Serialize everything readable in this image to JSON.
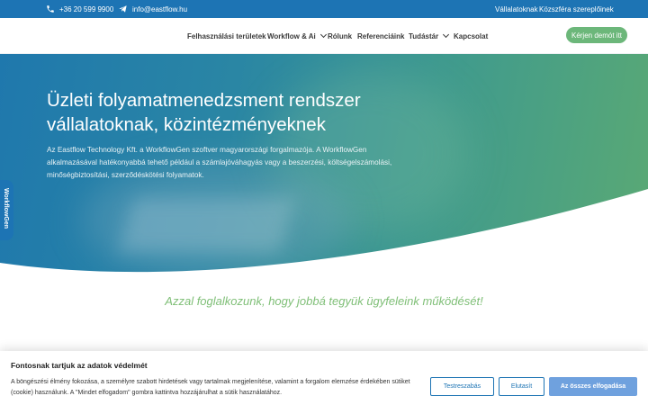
{
  "topbar": {
    "phone": "+36 20 599 9900",
    "email": "info@eastflow.hu",
    "links": [
      "Vállalatoknak",
      "Közszféra szereplőinek"
    ],
    "icons": [
      "phone-icon",
      "send-icon"
    ],
    "color": "#1d74b4"
  },
  "nav": {
    "items": [
      {
        "label": "Felhasználási területek"
      },
      {
        "label": "Workflow & Ai"
      },
      {
        "label": "Rólunk"
      },
      {
        "label": "Referenciáink"
      },
      {
        "label": "Tudástár"
      },
      {
        "label": "Kapcsolat"
      }
    ],
    "demo_button": "Kérjen demót itt",
    "demo_color": "#6cb77a"
  },
  "hero": {
    "title": "Üzleti folyamatmenedzsment rendszer vállalatoknak, közintézményeknek",
    "text": "Az Eastflow Technology Kft. a WorkflowGen szoftver magyarországi forgalmazója. A WorkflowGen alkalmazásával hatékonyabbá tehető például a számlajóváhagyás vagy a beszerzési, költségelszámolási, minőségbiztosítási, szerződéskötési folyamatok."
  },
  "side_tab": {
    "label": "WorkflowGen"
  },
  "tagline": "Azzal foglalkozunk, hogy jobbá tegyük ügyfeleink működését!",
  "cookie": {
    "title": "Fontosnak tartjuk az adatok védelmét",
    "text": "A böngészési élmény fokozása, a személyre szabott hirdetések vagy tartalmak megjelenítése, valamint a forgalom elemzése érdekében sütiket (cookie) használunk. A \"Mindet elfogadom\" gombra kattintva hozzájárulhat a sütik használatához.",
    "buttons": {
      "customize": "Testreszabás",
      "reject": "Elutasít",
      "accept_all": "Az összes elfogadása"
    }
  }
}
